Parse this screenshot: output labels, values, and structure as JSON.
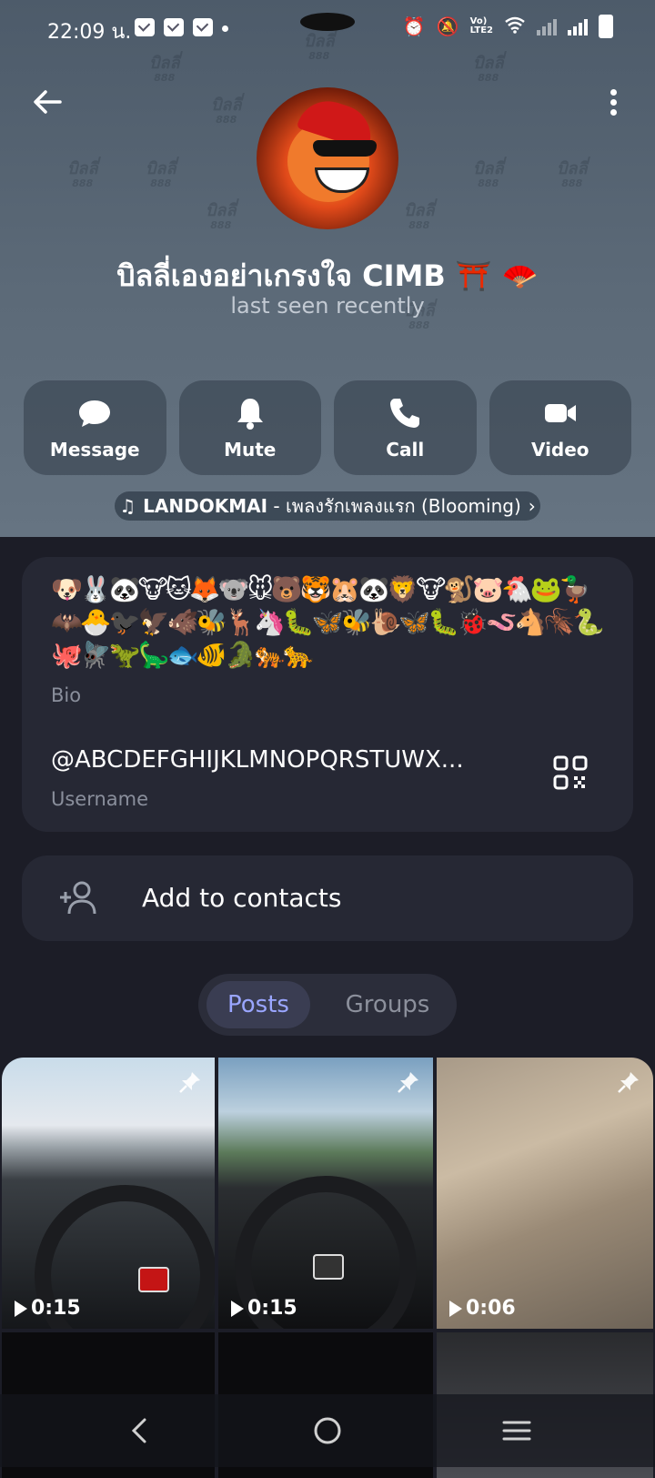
{
  "status_bar": {
    "time": "22:09 น."
  },
  "watermark": {
    "title": "บิลลี่",
    "sub": "888"
  },
  "profile": {
    "name": "บิลลี่เองอย่าเกรงใจ CIMB ⛩️ 🪭",
    "status": "last seen recently"
  },
  "actions": [
    {
      "label": "Message",
      "icon": "message-icon"
    },
    {
      "label": "Mute",
      "icon": "bell-icon"
    },
    {
      "label": "Call",
      "icon": "phone-icon"
    },
    {
      "label": "Video",
      "icon": "video-icon"
    }
  ],
  "music": {
    "artist": "LANDOKMAI",
    "separator": " - ",
    "title": "เพลงรักเพลงแรก (Blooming)"
  },
  "bio": {
    "text": "🐶🐰🐼🐮🐱🦊🐨🐭🐻🐯🐹🐼🦁🐮🐒🐷🐔🐸🦆🦇🐣🐦‍⬛🦅🐗🐝🦌🦄🐛🦋🐝🐌🦋🐛🐞🪱🐴🪳🐍🐙🪰🦖🦕🐟🐠🐊🐅🐆",
    "label": "Bio"
  },
  "username": {
    "value": "@ABCDEFGHIJKLMNOPQRSTUWX...",
    "label": "Username"
  },
  "add_contact": {
    "label": "Add to contacts"
  },
  "tabs": [
    {
      "label": "Posts",
      "active": true
    },
    {
      "label": "Groups",
      "active": false
    }
  ],
  "posts": [
    {
      "duration": "0:15",
      "pinned": true
    },
    {
      "duration": "0:15",
      "pinned": true
    },
    {
      "duration": "0:06",
      "pinned": true
    }
  ],
  "colors": {
    "accent": "#9aa6ff",
    "header": "#5c6a78",
    "background": "#1c1d27",
    "card": "#262834"
  }
}
